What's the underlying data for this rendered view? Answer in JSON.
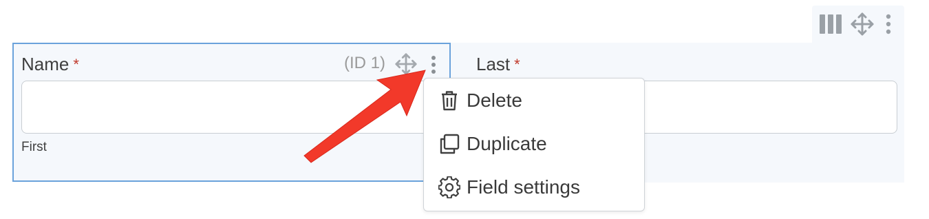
{
  "row_toolbar": {
    "columns_icon": "columns-icon",
    "move_icon": "move-icon",
    "more_icon": "more-vertical-icon"
  },
  "field_first": {
    "label": "Name",
    "required_mark": "*",
    "id_text": "(ID 1)",
    "move_icon": "move-icon",
    "more_icon": "more-vertical-icon",
    "input_value": "",
    "sublabel": "First"
  },
  "field_last": {
    "label": "Last",
    "required_mark": "*",
    "input_value": ""
  },
  "context_menu": {
    "items": [
      {
        "label": "Delete",
        "icon": "trash-icon"
      },
      {
        "label": "Duplicate",
        "icon": "duplicate-icon"
      },
      {
        "label": "Field settings",
        "icon": "gear-icon"
      }
    ]
  },
  "annotation": {
    "arrow_color": "#f2392a"
  },
  "colors": {
    "selected_border": "#6aa2db",
    "panel_background": "#f5f8fc",
    "required": "#c0392b"
  }
}
